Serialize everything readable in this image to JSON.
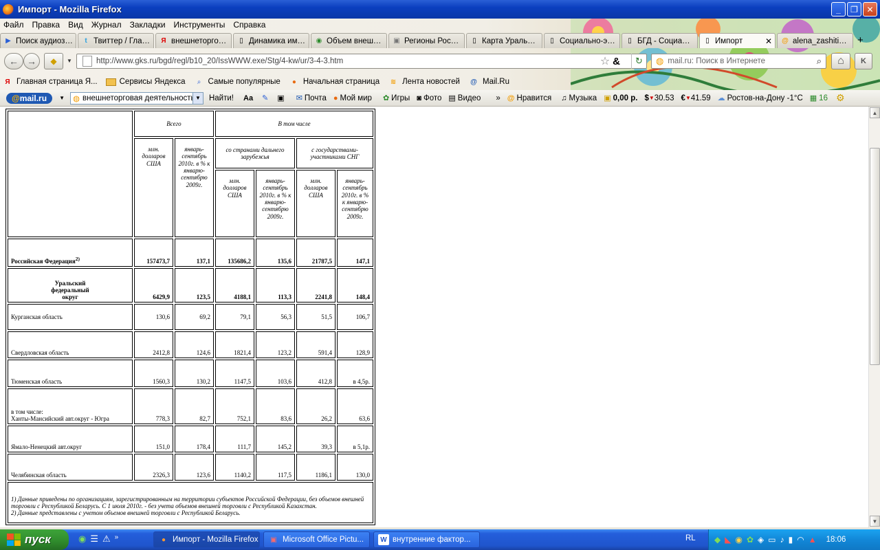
{
  "window": {
    "title": "Импорт - Mozilla Firefox",
    "minimize": "_",
    "maximize": "❐",
    "close": "✕"
  },
  "menu": [
    "Файл",
    "Правка",
    "Вид",
    "Журнал",
    "Закладки",
    "Инструменты",
    "Справка"
  ],
  "tabs": [
    {
      "label": "Поиск аудиоза...",
      "icon": "▶"
    },
    {
      "label": "Твиттер / Глав...",
      "icon": "t"
    },
    {
      "label": "внешнеторгов...",
      "icon": "Я"
    },
    {
      "label": "Динамика имп...",
      "icon": "▯"
    },
    {
      "label": "Объем внешне...",
      "icon": "◉"
    },
    {
      "label": "Регионы России",
      "icon": "▣"
    },
    {
      "label": "Карта Уральск...",
      "icon": "▯"
    },
    {
      "label": "Социально-эко...",
      "icon": "▯"
    },
    {
      "label": "БГД - Социаль...",
      "icon": "▯"
    },
    {
      "label": "Импорт",
      "icon": "▯",
      "close": "✕"
    },
    {
      "label": "alena_zashitina...",
      "icon": "@"
    }
  ],
  "tabs_new": "+",
  "nav": {
    "back": "←",
    "forward": "→",
    "url": "http://www.gks.ru/bgd/regl/b10_20/IssWWW.exe/Stg/4-kw/ur/3-4-3.htm",
    "bookmark_star": "☆",
    "amp": "&",
    "reload": "↻",
    "search_placeholder": "mail.ru: Поиск в Интернете",
    "home": "⌂",
    "k": "K"
  },
  "bookmarks": [
    {
      "label": "Главная страница Я...",
      "icon": "Я"
    },
    {
      "label": "Сервисы Яндекса",
      "icon": "▭"
    },
    {
      "label": "Самые популярные",
      "icon": "⌕"
    },
    {
      "label": "Начальная страница",
      "icon": "●"
    },
    {
      "label": "Лента новостей",
      "icon": "≋"
    },
    {
      "label": "Mail.Ru",
      "icon": "@"
    }
  ],
  "mailbar": {
    "logo_at": "@",
    "logo_text": "mail.ru",
    "query": "внешнеторговая деятельность",
    "find": "Найти!",
    "mail": "Почта",
    "myworld": "Мой мир",
    "games": "Игры",
    "photo": "Фото",
    "video": "Видео",
    "more": "»",
    "likes": "Нравится",
    "music": "Музыка",
    "balance": "0,00 р.",
    "usd_sign": "$",
    "usd": "30.53",
    "eur_sign": "€",
    "eur": "41.59",
    "weather": "Ростов-на-Дону -1°C",
    "count": "16"
  },
  "table": {
    "head_total": "Всего",
    "head_including": "В том числе",
    "head_far": "со странами дальнего зарубежья",
    "head_cis": "с государствами-участниками СНГ",
    "col_mln": "млн. долларов США",
    "col_pct": "январь-сентябрь 2010г. в % к январю-сентябрю 2009г.",
    "rows": [
      {
        "name": "Российская Федерация",
        "sup": "2)",
        "v": [
          "157473,7",
          "137,1",
          "135686,2",
          "135,6",
          "21787,5",
          "147,1"
        ],
        "bold": true
      },
      {
        "name": "Уральский федеральный округ",
        "v": [
          "6429,9",
          "123,5",
          "4188,1",
          "113,3",
          "2241,8",
          "148,4"
        ],
        "bold": true
      },
      {
        "name": "Курганская область",
        "v": [
          "130,6",
          "69,2",
          "79,1",
          "56,3",
          "51,5",
          "106,7"
        ]
      },
      {
        "name": "Свердловская область",
        "v": [
          "2412,8",
          "124,6",
          "1821,4",
          "123,2",
          "591,4",
          "128,9"
        ]
      },
      {
        "name": "Тюменская область",
        "v": [
          "1560,3",
          "130,2",
          "1147,5",
          "103,6",
          "412,8",
          "в 4,5р."
        ]
      },
      {
        "name": "в том числе:",
        "name2": "Ханты-Мансийский авт.округ - Югра",
        "v": [
          "778,3",
          "82,7",
          "752,1",
          "83,6",
          "26,2",
          "63,6"
        ]
      },
      {
        "name": "Ямало-Ненецкий авт.округ",
        "v": [
          "151,0",
          "178,4",
          "111,7",
          "145,2",
          "39,3",
          "в 5,1р."
        ]
      },
      {
        "name": "Челябинская область",
        "v": [
          "2326,3",
          "123,6",
          "1140,2",
          "117,5",
          "1186,1",
          "130,0"
        ]
      }
    ],
    "footnote1": "1) Данные приведены по организациям, зарегистрированным на территории субъектов Российской Федерации, без объемов внешней торговли с Республикой Беларусь. С 1 июля 2010г. - без учета объемов внешней торговли с Республикой Казахстан.",
    "footnote2": "2) Данные представлены с учетом объемов внешней торговли с Республикой Беларусь."
  },
  "scroll": {
    "up": "▲",
    "down": "▼"
  },
  "taskbar": {
    "start": "пуск",
    "tasks": [
      {
        "label": "Импорт - Mozilla Firefox",
        "icon": "●"
      },
      {
        "label": "Microsoft Office Pictu...",
        "icon": "▣"
      },
      {
        "label": "внутренние фактор...",
        "icon": "W"
      }
    ],
    "lang": "RL",
    "clock": "18:06"
  }
}
